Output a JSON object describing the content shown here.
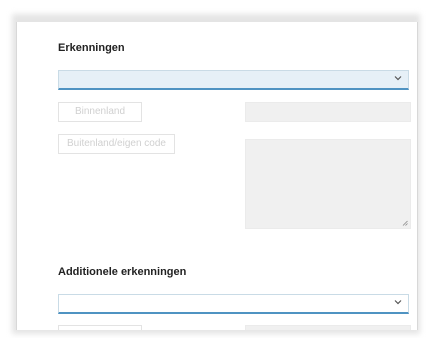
{
  "section1": {
    "title": "Erkenningen",
    "select_value": "",
    "button_domestic": "Binnenland",
    "button_foreign": "Buitenland/eigen code"
  },
  "section2": {
    "title": "Additionele erkenningen",
    "select_value": ""
  },
  "icons": {
    "dropdown": "chevron-down-icon",
    "resize": "resize-grip-icon"
  },
  "colors": {
    "accent": "#4f93c2",
    "select_fill": "#e6f0f7",
    "field_fill": "#f0f0f0"
  }
}
